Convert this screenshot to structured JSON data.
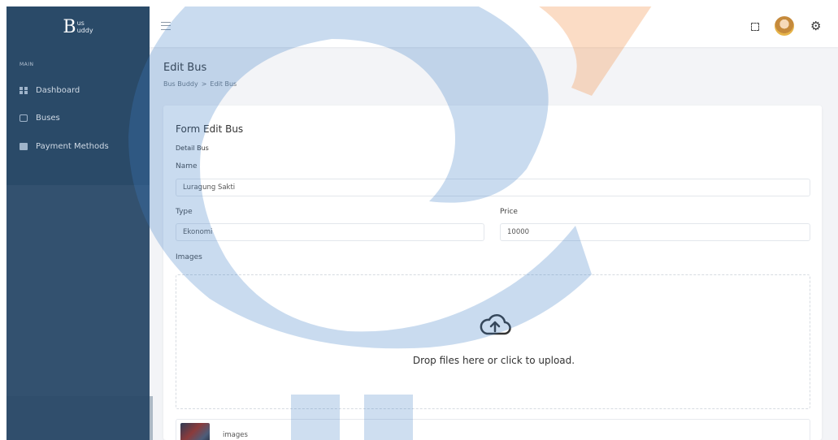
{
  "brand": {
    "letter": "B",
    "top": "us",
    "bottom": "uddy"
  },
  "sidebar": {
    "section_title": "MAIN",
    "items": [
      {
        "label": "Dashboard",
        "icon": "grid-icon"
      },
      {
        "label": "Buses",
        "icon": "bus-icon"
      },
      {
        "label": "Payment Methods",
        "icon": "card-icon"
      }
    ]
  },
  "header": {
    "menu_icon": "hamburger-icon",
    "fullscreen_icon": "fullscreen-icon",
    "avatar_icon": "avatar",
    "settings_icon": "gear-icon"
  },
  "page": {
    "title": "Edit Bus",
    "breadcrumb": {
      "root": "Bus Buddy",
      "separator": ">",
      "current": "Edit Bus"
    }
  },
  "form": {
    "title": "Form Edit Bus",
    "section": "Detail Bus",
    "name_label": "Name",
    "name_value": "Luragung Sakti",
    "type_label": "Type",
    "type_value": "Ekonomi",
    "price_label": "Price",
    "price_value": "10000",
    "images_label": "Images",
    "dropzone_text": "Drop files here or click to upload.",
    "preview_name": "images"
  },
  "colors": {
    "sidebar": "#2a4a68",
    "background": "#f3f4f7",
    "watermark_blue": "#2f6fbf",
    "watermark_orange": "#f39a5a"
  }
}
